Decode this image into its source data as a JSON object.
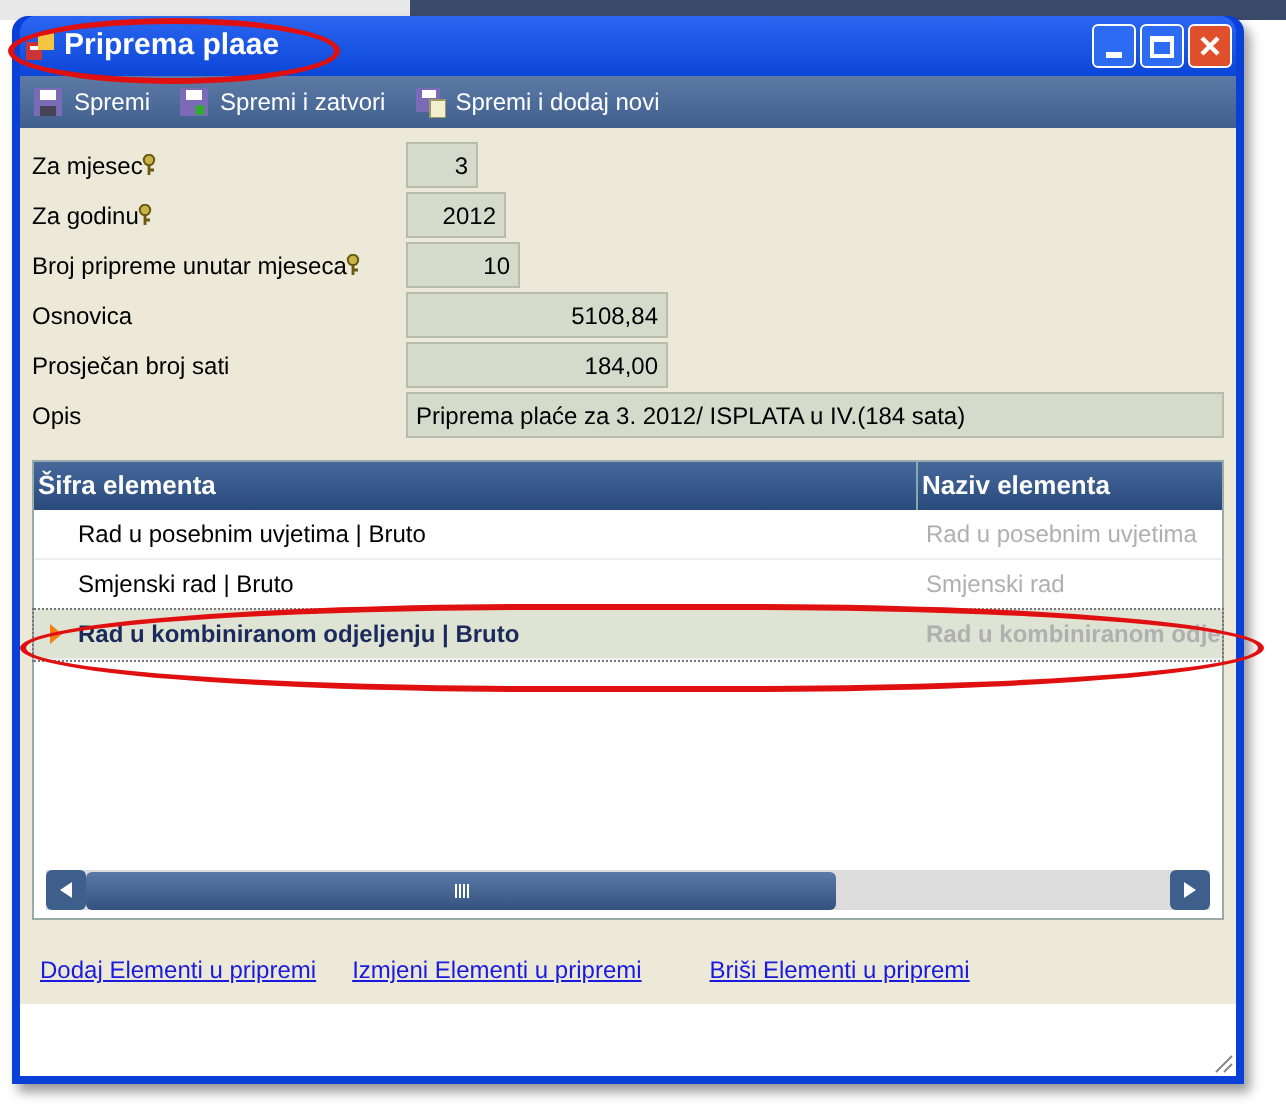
{
  "window": {
    "title": "Priprema plaae"
  },
  "toolbar": [
    {
      "label": "Spremi",
      "kind": "save"
    },
    {
      "label": "Spremi i zatvori",
      "kind": "save_close"
    },
    {
      "label": "Spremi i dodaj novi",
      "kind": "save_new"
    }
  ],
  "form": [
    {
      "label": "Za mjesec",
      "key_icon": true,
      "value": "3"
    },
    {
      "label": "Za godinu",
      "key_icon": true,
      "value": "2012"
    },
    {
      "label": "Broj pripreme unutar mjeseca",
      "key_icon": true,
      "value": "10"
    },
    {
      "label": "Osnovica",
      "key_icon": false,
      "value": "5108,84"
    },
    {
      "label": "Prosječan broj sati",
      "key_icon": false,
      "value": "184,00"
    },
    {
      "label": "Opis",
      "key_icon": false,
      "value": "Priprema plaće za 3. 2012/ ISPLATA u IV.(184 sata)"
    }
  ],
  "table": {
    "columns": [
      "Šifra elementa",
      "Naziv elementa"
    ],
    "rows": [
      {
        "cells": [
          "Rad u posebnim uvjetima | Bruto",
          "Rad u posebnim uvjetima"
        ],
        "selected": false
      },
      {
        "cells": [
          "Smjenski rad | Bruto",
          "Smjenski rad"
        ],
        "selected": false
      },
      {
        "cells": [
          "Rad u kombiniranom odjeljenju | Bruto",
          "Rad u kombiniranom odje"
        ],
        "selected": true
      }
    ]
  },
  "links": [
    "Dodaj Elementi u pripremi",
    "Izmjeni Elementi u pripremi",
    "Briši Elementi u pripremi"
  ]
}
